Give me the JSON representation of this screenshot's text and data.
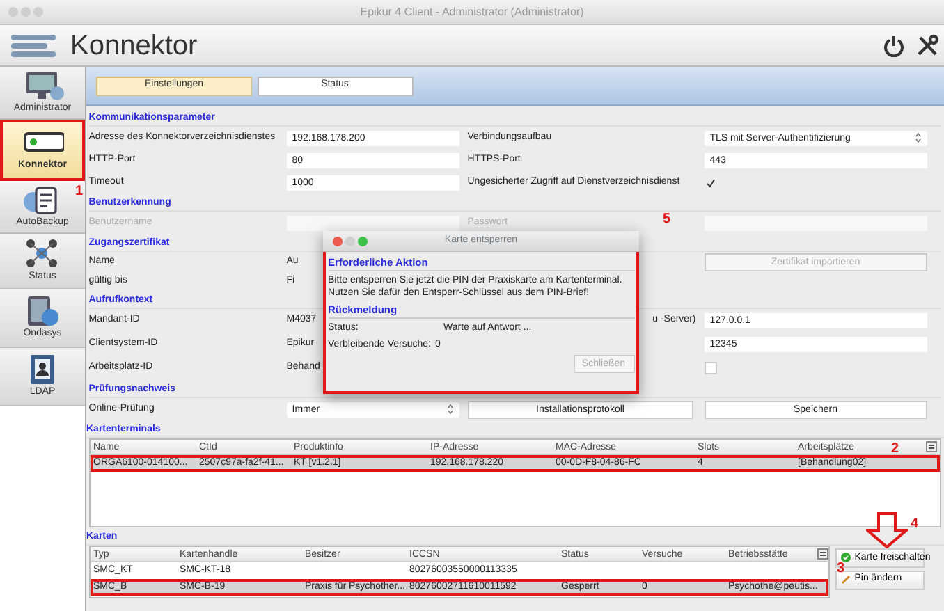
{
  "window": {
    "title": "Epikur 4 Client - Administrator (Administrator)"
  },
  "header": {
    "title": "Konnektor"
  },
  "sidebar": {
    "items": [
      {
        "label": "Administrator",
        "kind": "monitor",
        "selected": false,
        "highlighted": false
      },
      {
        "label": "Konnektor",
        "kind": "device",
        "selected": true,
        "highlighted": true
      },
      {
        "label": "AutoBackup",
        "kind": "backup",
        "selected": false,
        "highlighted": false
      },
      {
        "label": "Status",
        "kind": "network",
        "selected": false,
        "highlighted": false
      },
      {
        "label": "Ondasys",
        "kind": "tablet",
        "selected": false,
        "highlighted": false
      },
      {
        "label": "LDAP",
        "kind": "book",
        "selected": false,
        "highlighted": false
      }
    ]
  },
  "tabs": [
    {
      "label": "Einstellungen",
      "selected": true
    },
    {
      "label": "Status",
      "selected": false
    }
  ],
  "sections": [
    {
      "title": "Kommunikationsparameter",
      "rows": [
        {
          "left": {
            "label": "Adresse des Konnektorverzeichnisdienstes",
            "kind": "field",
            "value": "192.168.178.200",
            "disabled": false
          },
          "right": {
            "label": "Verbindungsaufbau",
            "kind": "select",
            "value": "TLS mit Server-Authentifizierung"
          }
        },
        {
          "left": {
            "label": "HTTP-Port",
            "kind": "field",
            "value": "80",
            "disabled": false
          },
          "right": {
            "label": "HTTPS-Port",
            "kind": "field",
            "value": "443"
          }
        },
        {
          "left": {
            "label": "Timeout",
            "kind": "field",
            "value": "1000",
            "disabled": false
          },
          "right": {
            "label": "Ungesicherter Zugriff auf Dienstverzeichnisdienst",
            "kind": "checkbox",
            "checked": true
          }
        }
      ]
    },
    {
      "title": "Benutzerkennung",
      "rows": [
        {
          "left": {
            "label": "Benutzername",
            "kind": "field",
            "disabled": true
          },
          "right": {
            "label": "Passwort",
            "kind": "field",
            "disabled": true
          }
        }
      ]
    },
    {
      "title": "Zugangszertifikat",
      "rows": [
        {
          "left": {
            "label": "Name",
            "kind": "text",
            "value": "Au",
            "disabled": false
          },
          "right": {
            "kind": "button",
            "value": "Zertifikat importieren",
            "disabled": true
          }
        },
        {
          "left": {
            "label": "gültig bis",
            "kind": "text",
            "value": "Fi",
            "disabled": false
          }
        }
      ]
    },
    {
      "title": "Aufrufkontext",
      "rows": [
        {
          "left": {
            "label": "Mandant-ID",
            "kind": "text",
            "value": "M4037",
            "disabled": false
          },
          "right": {
            "label": "u -Server)",
            "kind": "field",
            "value": "127.0.0.1"
          }
        },
        {
          "left": {
            "label": "Clientsystem-ID",
            "kind": "text",
            "value": "Epikur",
            "disabled": false
          },
          "right": {
            "kind": "field",
            "value": "12345"
          }
        },
        {
          "left": {
            "label": "Arbeitsplatz-ID",
            "kind": "text",
            "value": "Behand",
            "disabled": false
          },
          "right": {
            "kind": "checkbox",
            "checked": false
          }
        }
      ]
    },
    {
      "title": "Prüfungsnachweis",
      "rows": [
        {
          "left": {
            "label": "Online-Prüfung",
            "kind": "select",
            "value": "Immer",
            "disabled": false
          },
          "right": {
            "kind": "button-pair",
            "buttons": [
              {
                "label": "Installationsprotokoll",
                "disabled": false
              },
              {
                "label": "Speichern",
                "disabled": false
              }
            ]
          }
        }
      ]
    }
  ],
  "terminals": {
    "title": "Kartenterminals",
    "columns": [
      "Name",
      "CtId",
      "Produktinfo",
      "IP-Adresse",
      "MAC-Adresse",
      "Slots",
      "Arbeitsplätze"
    ],
    "rows": [
      {
        "cells": [
          "ORGA6100-014100...",
          "2507c97a-fa2f-41...",
          "KT [v1.2.1]",
          "192.168.178.220",
          "00-0D-F8-04-86-FC",
          "4",
          "[Behandlung02]"
        ],
        "selected": true,
        "highlighted": true
      }
    ]
  },
  "cards": {
    "title": "Karten",
    "columns": [
      "Typ",
      "Kartenhandle",
      "Besitzer",
      "ICCSN",
      "Status",
      "Versuche",
      "Betriebsstätte"
    ],
    "rows": [
      {
        "cells": [
          "SMC_KT",
          "SMC-KT-18",
          "",
          "80276003550000113335",
          "",
          "",
          ""
        ],
        "selected": false,
        "highlighted": false
      },
      {
        "cells": [
          "SMC_B",
          "SMC-B-19",
          "Praxis für Psychother...",
          "80276002711610011592",
          "Gesperrt",
          "0",
          "Psychothe@peutis..."
        ],
        "selected": true,
        "highlighted": true
      }
    ]
  },
  "card_actions": [
    {
      "label": "Karte freischalten",
      "kind": "unlock"
    },
    {
      "label": "Pin ändern",
      "kind": "edit"
    }
  ],
  "dialog": {
    "title": "Karte entsperren",
    "highlighted": true,
    "action": {
      "title": "Erforderliche Aktion",
      "lines": [
        "Bitte entsperren Sie jetzt die PIN der Praxiskarte am Kartenterminal.",
        "Nutzen Sie dafür den Entsperr-Schlüssel aus dem PIN-Brief!"
      ]
    },
    "feedback": {
      "title": "Rückmeldung",
      "fields": [
        {
          "label": "Status:",
          "value": "Warte auf Antwort ..."
        },
        {
          "label": "Verbleibende Versuche:",
          "value": "0"
        }
      ]
    },
    "button": {
      "label": "Schließen",
      "disabled": true
    }
  },
  "annotations": [
    {
      "text": "1"
    },
    {
      "text": "2"
    },
    {
      "text": "3"
    },
    {
      "text": "4"
    },
    {
      "text": "5"
    }
  ]
}
